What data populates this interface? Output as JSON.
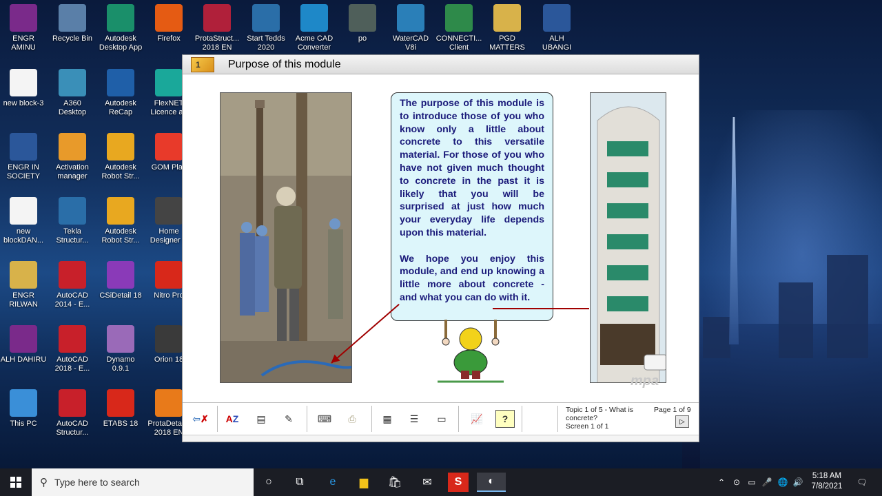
{
  "desktop_icons": [
    {
      "label": "ENGR\nAMINU",
      "color": "#7a2a8a"
    },
    {
      "label": "Recycle Bin",
      "color": "#5a7fa8"
    },
    {
      "label": "Autodesk\nDesktop App",
      "color": "#1a8f6a"
    },
    {
      "label": "Firefox",
      "color": "#e55b13"
    },
    {
      "label": "ProtaStruct...\n2018 EN",
      "color": "#b0203a"
    },
    {
      "label": "Start Tedds\n2020",
      "color": "#2a6ea8"
    },
    {
      "label": "Acme CAD\nConverter",
      "color": "#1e88c8"
    },
    {
      "label": "po",
      "color": "#4f5f5a"
    },
    {
      "label": "WaterCAD\nV8i",
      "color": "#2a7fb8"
    },
    {
      "label": "CONNECTI...\nClient",
      "color": "#2e8a4a"
    },
    {
      "label": "PGD\nMATTERS",
      "color": "#d8b24a"
    },
    {
      "label": "ALH\nUBANGI",
      "color": "#2b579a"
    },
    {
      "label": "new block-3",
      "color": "#f4f4f4"
    },
    {
      "label": "A360\nDesktop",
      "color": "#3a8fb8"
    },
    {
      "label": "Autodesk\nReCap",
      "color": "#1f5fa8"
    },
    {
      "label": "FlexNET\nLicence ad",
      "color": "#1aa89a"
    },
    {
      "label": "ENGR IN\nSOCIETY",
      "color": "#2b579a"
    },
    {
      "label": "Activation\nmanager",
      "color": "#e89a2a"
    },
    {
      "label": "Autodesk\nRobot Str...",
      "color": "#e8a820"
    },
    {
      "label": "GOM Play",
      "color": "#e83a2a"
    },
    {
      "label": "new\nblockDAN...",
      "color": "#f4f4f4"
    },
    {
      "label": "Tekla\nStructur...",
      "color": "#2a6ea8"
    },
    {
      "label": "Autodesk\nRobot Str...",
      "color": "#e8a820"
    },
    {
      "label": "Home\nDesigner P",
      "color": "#444"
    },
    {
      "label": "ENGR\nRILWAN",
      "color": "#d8b24a"
    },
    {
      "label": "AutoCAD\n2014 - E...",
      "color": "#c8202a"
    },
    {
      "label": "CSiDetail 18",
      "color": "#8a3ab8"
    },
    {
      "label": "Nitro Pro",
      "color": "#d8281a"
    },
    {
      "label": "ALH DAHIRU",
      "color": "#7a2a8a"
    },
    {
      "label": "AutoCAD\n2018 - E...",
      "color": "#c8202a"
    },
    {
      "label": "Dynamo\n0.9.1",
      "color": "#9a6ab8"
    },
    {
      "label": "Orion 18",
      "color": "#3a3a3a"
    },
    {
      "label": "This PC",
      "color": "#3a8fd8"
    },
    {
      "label": "AutoCAD\nStructur...",
      "color": "#c8202a"
    },
    {
      "label": "ETABS 18",
      "color": "#d8281a"
    },
    {
      "label": "ProtaDetai...\n2018 EN",
      "color": "#e87a1a"
    }
  ],
  "module": {
    "number": "1",
    "title": "Purpose of this module",
    "paragraph1": "The purpose of this module is to introduce those of you who know only a little about concrete to this versatile material. For those of you who have not given much thought to concrete in the past it is likely that you will be surprised at just how much your everyday life depends upon this material.",
    "paragraph2": "We hope you enjoy this module, and end up knowing a little more about concrete - and what you can do with it.",
    "watermark": "mpa",
    "topic_line1": "Topic 1 of 5 - What is",
    "topic_line2": "concrete?",
    "screen_info": "Screen 1 of 1",
    "page_info": "Page 1 of 9"
  },
  "taskbar": {
    "search_placeholder": "Type here to search",
    "time": "5:18 AM",
    "date": "7/8/2021"
  },
  "colors": {
    "text_box_bg": "#ddf6fb",
    "text_color": "#1a1a7a",
    "arrow_color": "#a00000"
  }
}
